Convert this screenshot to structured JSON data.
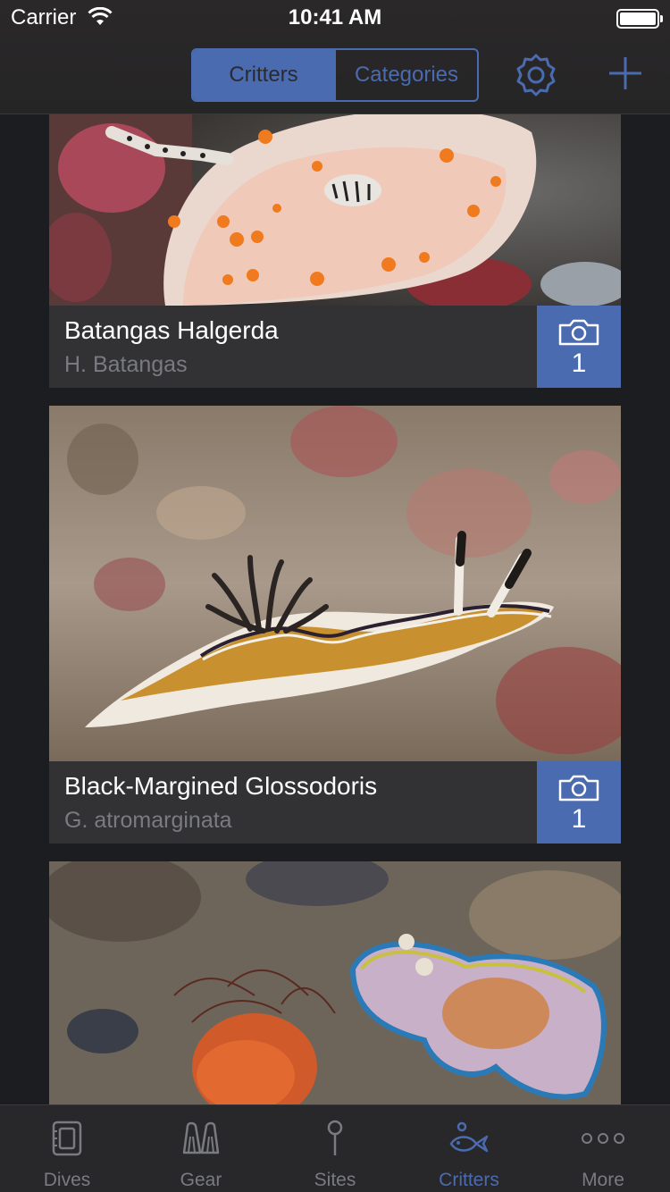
{
  "status_bar": {
    "carrier": "Carrier",
    "time": "10:41 AM"
  },
  "nav": {
    "segments": [
      {
        "label": "Critters",
        "selected": true
      },
      {
        "label": "Categories",
        "selected": false
      }
    ],
    "settings_icon": "gear-icon",
    "add_icon": "plus-icon"
  },
  "critters": [
    {
      "name": "Batangas Halgerda",
      "scientific": "H. Batangas",
      "photo_count": "1"
    },
    {
      "name": "Black-Margined Glossodoris",
      "scientific": "G. atromarginata",
      "photo_count": "1"
    },
    {
      "name": "",
      "scientific": "",
      "photo_count": ""
    }
  ],
  "tab_bar": {
    "tabs": [
      {
        "label": "Dives",
        "icon": "dive-log-icon",
        "selected": false
      },
      {
        "label": "Gear",
        "icon": "fins-icon",
        "selected": false
      },
      {
        "label": "Sites",
        "icon": "pin-icon",
        "selected": false
      },
      {
        "label": "Critters",
        "icon": "fish-icon",
        "selected": true
      },
      {
        "label": "More",
        "icon": "more-dots-icon",
        "selected": false
      }
    ]
  },
  "colors": {
    "accent": "#4a6bb0",
    "background": "#1c1d21",
    "caption": "#323234"
  }
}
